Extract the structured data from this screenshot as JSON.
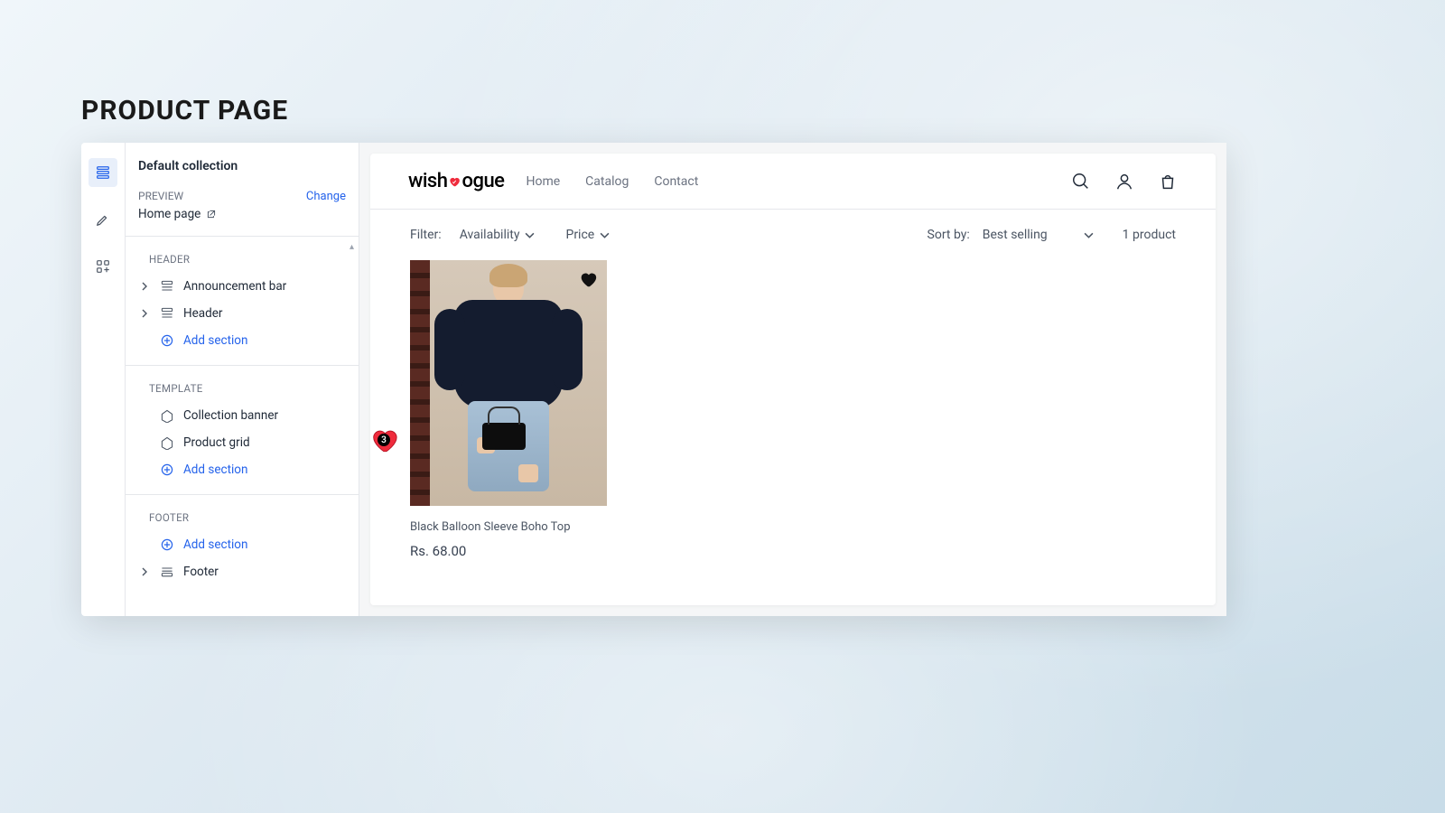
{
  "page": {
    "heading": "PRODUCT PAGE"
  },
  "sidebar": {
    "title": "Default collection",
    "preview_label": "PREVIEW",
    "preview_value": "Home page",
    "change_label": "Change",
    "groups": {
      "header": {
        "label": "HEADER",
        "items": [
          "Announcement bar",
          "Header"
        ],
        "add": "Add section"
      },
      "template": {
        "label": "TEMPLATE",
        "items": [
          "Collection banner",
          "Product grid"
        ],
        "add": "Add section"
      },
      "footer": {
        "label": "FOOTER",
        "add": "Add section",
        "items": [
          "Footer"
        ]
      }
    }
  },
  "store": {
    "logo_left": "wish",
    "logo_right": "ogue",
    "nav": {
      "home": "Home",
      "catalog": "Catalog",
      "contact": "Contact"
    },
    "filter_label": "Filter:",
    "filters": {
      "availability": "Availability",
      "price": "Price"
    },
    "sort_label": "Sort by:",
    "sort_value": "Best selling",
    "count": "1 product",
    "wishlist_count": "3",
    "product": {
      "title": "Black Balloon Sleeve Boho Top",
      "price": "Rs. 68.00"
    }
  },
  "colors": {
    "accent": "#2563eb",
    "heart": "#ef2b3c"
  }
}
